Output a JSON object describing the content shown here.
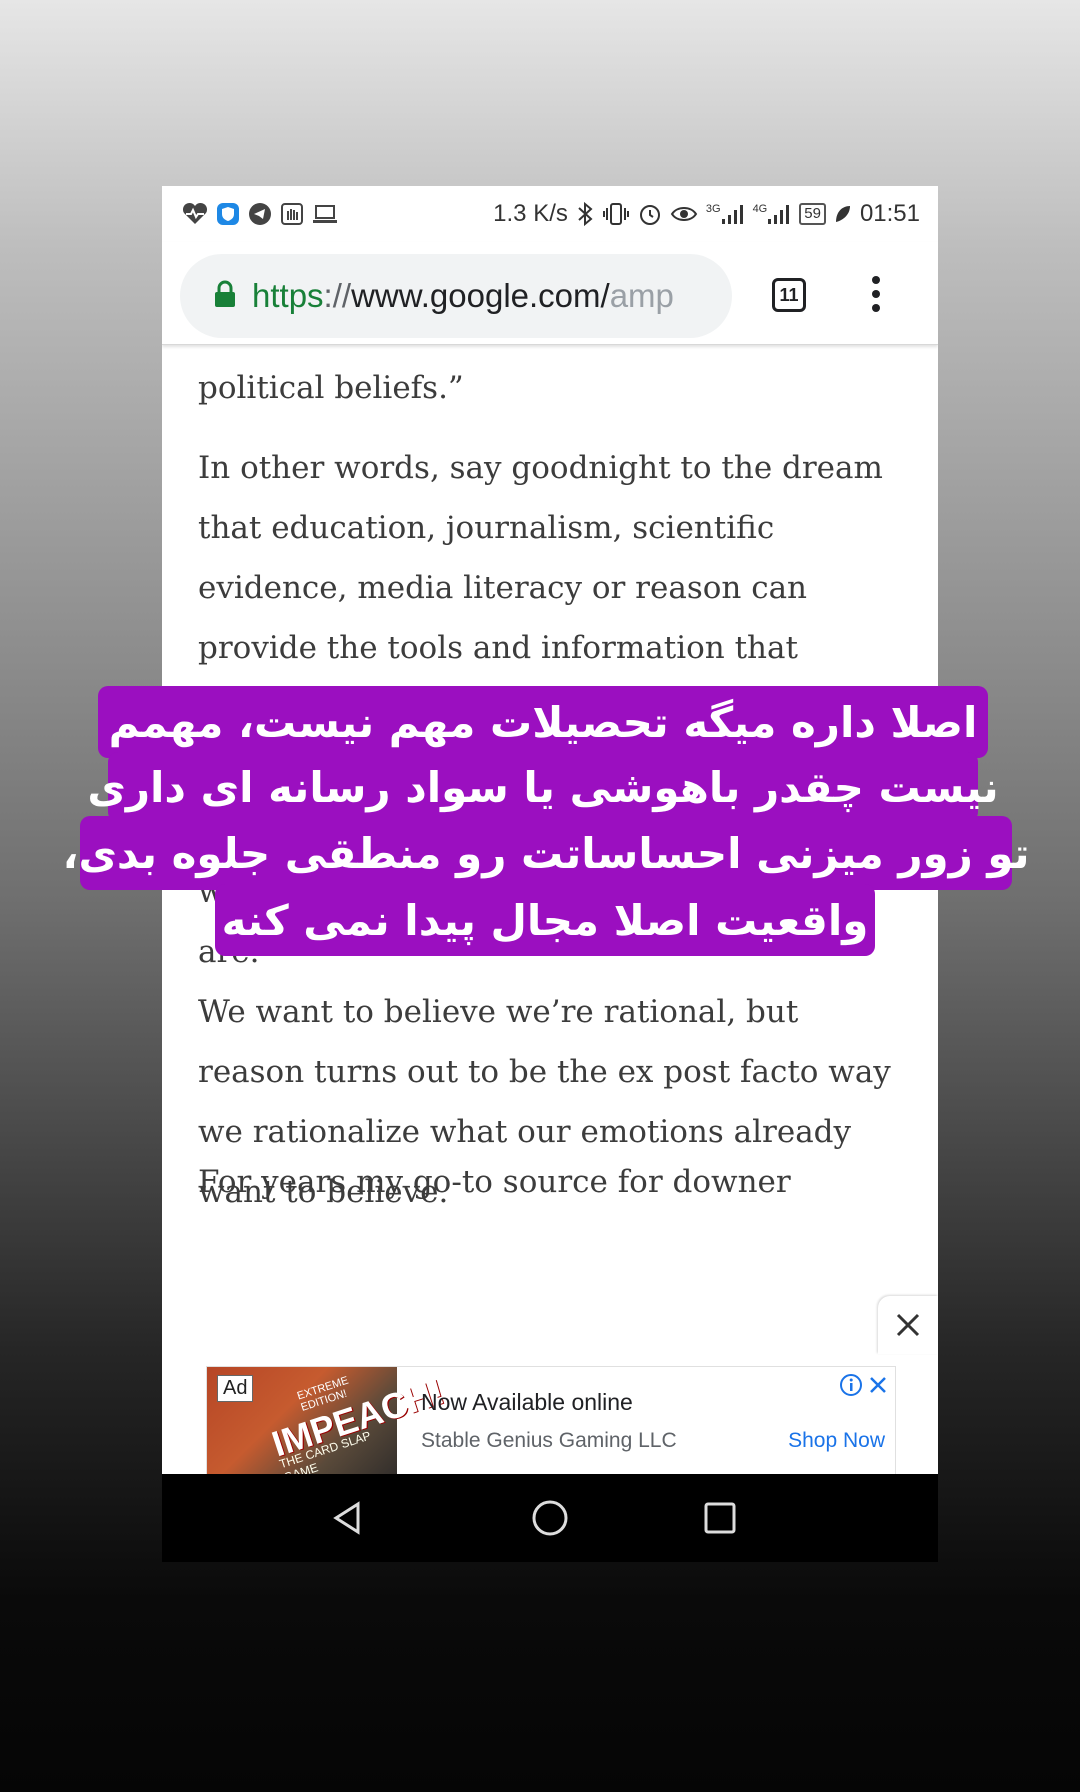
{
  "status_bar": {
    "speed": "1.3 K/s",
    "net_3g": "3G",
    "net_4g": "4G",
    "battery": "59",
    "time": "01:51"
  },
  "browser": {
    "url_scheme": "https",
    "url_slashes": "://",
    "url_host": "www.google.com/",
    "url_fade": "amp",
    "tab_count": "11"
  },
  "article": {
    "p0": "political beliefs.”",
    "p1": "In other words, say goodnight to the dream\nthat education, journalism, scientific\nevidence, media literacy or reason can\nprovide the tools and information that",
    "p2_partial": "p",
    "p3": "work, no matter how smart we think we are.\nWe want to believe we’re rational, but\nreason turns out to be the ex post facto way\nwe rationalize what our emotions already\nwant to believe.",
    "p4": "For years my go-to source for downer"
  },
  "overlay_text": [
    "اصلا داره میگه تحصیلات مهم نیست، مهمم",
    "نیست چقدر باهوشی یا سواد رسانه ای داری",
    "تو زور میزنی احساساتت رو منطقی جلوه بدی،",
    "واقعیت اصلا مجال پیدا نمی کنه"
  ],
  "ad": {
    "badge": "Ad",
    "image_logo": "IMPEACH!",
    "image_sub": "THE CARD SLAP GAME",
    "image_ext": "EXTREME EDITION!",
    "title": "Now Available online",
    "advertiser": "Stable Genius Gaming LLC",
    "cta": "Shop Now"
  },
  "colors": {
    "overlay_bg": "#9b0fc0",
    "url_green": "#188038",
    "link_blue": "#1a73e8"
  }
}
